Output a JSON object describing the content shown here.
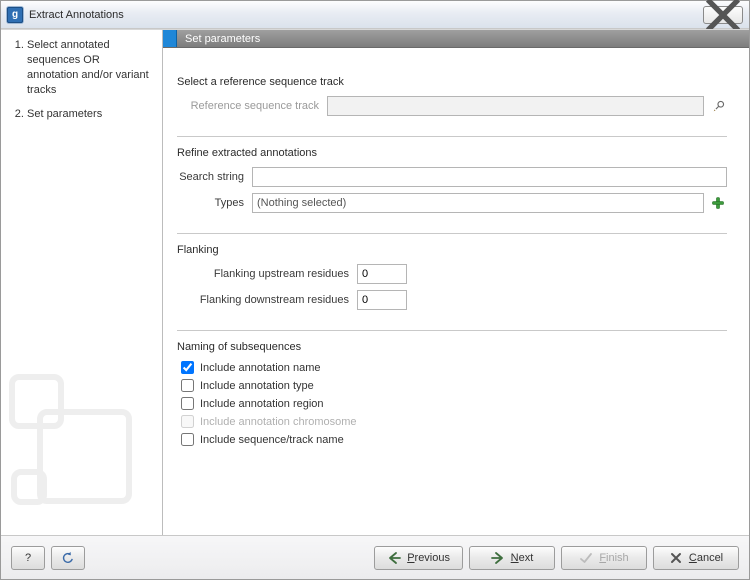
{
  "window": {
    "title": "Extract Annotations"
  },
  "steps": {
    "items": [
      {
        "label": "Select annotated sequences OR annotation and/or variant tracks"
      },
      {
        "label": "Set parameters"
      }
    ]
  },
  "header": {
    "current_step_title": "Set parameters"
  },
  "reference_section": {
    "title": "Select a reference sequence track",
    "field_label": "Reference sequence track",
    "value": "",
    "browse_icon": "browse-icon"
  },
  "refine_section": {
    "title": "Refine extracted annotations",
    "search_label": "Search string",
    "search_value": "",
    "types_label": "Types",
    "types_value": "(Nothing selected)",
    "add_icon": "plus-icon"
  },
  "flanking_section": {
    "title": "Flanking",
    "upstream_label": "Flanking upstream residues",
    "upstream_value": "0",
    "downstream_label": "Flanking downstream residues",
    "downstream_value": "0"
  },
  "naming_section": {
    "title": "Naming of subsequences",
    "options": [
      {
        "label": "Include annotation name",
        "checked": true,
        "enabled": true
      },
      {
        "label": "Include annotation type",
        "checked": false,
        "enabled": true
      },
      {
        "label": "Include annotation region",
        "checked": false,
        "enabled": true
      },
      {
        "label": "Include annotation chromosome",
        "checked": false,
        "enabled": false
      },
      {
        "label": "Include sequence/track name",
        "checked": false,
        "enabled": true
      }
    ]
  },
  "footer_buttons": {
    "help": "?",
    "reset": "reset",
    "previous": "Previous",
    "next": "Next",
    "finish": "Finish",
    "cancel": "Cancel"
  }
}
